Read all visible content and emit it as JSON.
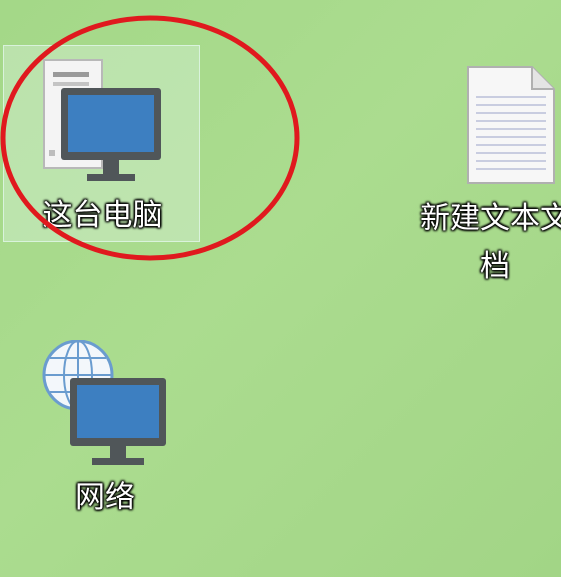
{
  "desktop": {
    "icons": [
      {
        "label": "这台电脑",
        "icon": "this-pc-icon",
        "selected": true
      },
      {
        "label": "新建文本文档",
        "icon": "text-document-icon",
        "selected": false
      },
      {
        "label": "网络",
        "icon": "network-icon",
        "selected": false
      }
    ],
    "annotation_color": "#e0191e",
    "selection_color": "#d8f0d8"
  }
}
